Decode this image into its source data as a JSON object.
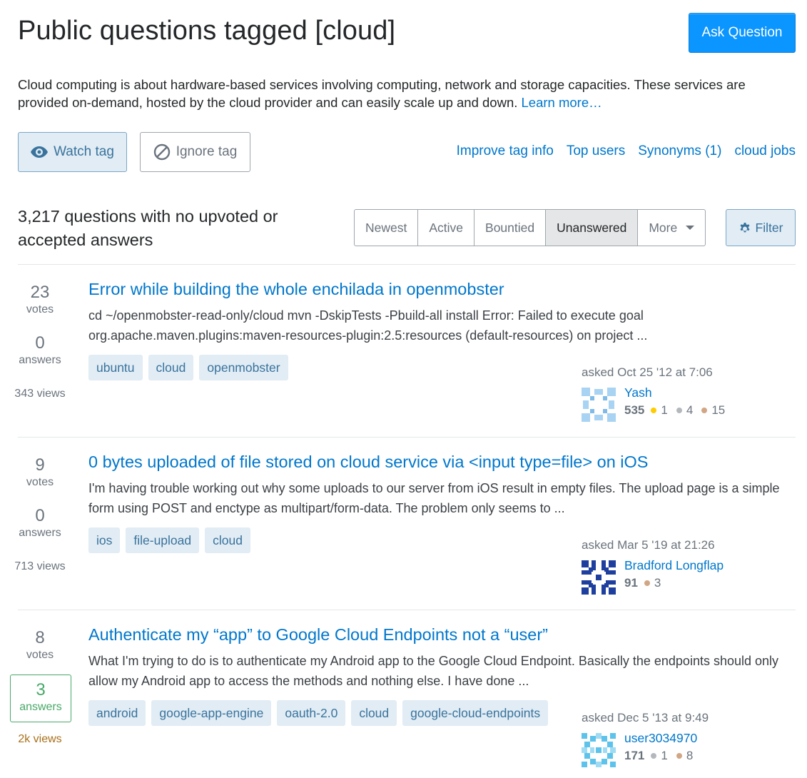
{
  "header": {
    "title": "Public questions tagged [cloud]",
    "ask_label": "Ask Question"
  },
  "description": {
    "text": "Cloud computing is about hardware-based services involving computing, network and storage capacities. These services are provided on-demand, hosted by the cloud provider and can easily scale up and down.",
    "learn_more": "Learn more…"
  },
  "tag_actions": {
    "watch_label": "Watch tag",
    "ignore_label": "Ignore tag",
    "links": [
      "Improve tag info",
      "Top users",
      "Synonyms (1)",
      "cloud jobs"
    ]
  },
  "count_text": "3,217 questions with no upvoted or accepted answers",
  "sort_tabs": [
    "Newest",
    "Active",
    "Bountied",
    "Unanswered",
    "More"
  ],
  "selected_tab": "Unanswered",
  "filter_label": "Filter",
  "colors": {
    "link": "#0077cc",
    "accent": "#0a95ff",
    "tag_bg": "#e1ecf4",
    "answered_green": "#48a868",
    "gold": "#ffcc01",
    "silver": "#b4b8bc",
    "bronze": "#d1a684"
  },
  "questions": [
    {
      "votes": "23",
      "votes_label": "votes",
      "answers": "0",
      "answers_label": "answers",
      "views": "343 views",
      "title": "Error while building the whole enchilada in openmobster",
      "excerpt": "cd ~/openmobster-read-only/cloud mvn -DskipTests -Pbuild-all install Error: Failed to execute goal org.apache.maven.plugins:maven-resources-plugin:2.5:resources (default-resources) on project ...",
      "tags": [
        "ubuntu",
        "cloud",
        "openmobster"
      ],
      "asked": "asked Oct 25 '12 at 7:06",
      "user": "Yash",
      "rep": "535",
      "gold": "1",
      "silver": "4",
      "bronze": "15"
    },
    {
      "votes": "9",
      "votes_label": "votes",
      "answers": "0",
      "answers_label": "answers",
      "views": "713 views",
      "title": "0 bytes uploaded of file stored on cloud service via <input type=file> on iOS",
      "excerpt": "I'm having trouble working out why some uploads to our server from iOS result in empty files. The upload page is a simple form using POST and enctype as multipart/form-data. The problem only seems to ...",
      "tags": [
        "ios",
        "file-upload",
        "cloud"
      ],
      "asked": "asked Mar 5 '19 at 21:26",
      "user": "Bradford Longflap",
      "rep": "91",
      "bronze": "3"
    },
    {
      "votes": "8",
      "votes_label": "votes",
      "answers": "3",
      "answers_label": "answers",
      "views": "2k views",
      "title": "Authenticate my “app” to Google Cloud Endpoints not a “user”",
      "excerpt": "What I'm trying to do is to authenticate my Android app to the Google Cloud Endpoint. Basically the endpoints should only allow my Android app to access the methods and nothing else. I have done ...",
      "tags": [
        "android",
        "google-app-engine",
        "oauth-2.0",
        "cloud",
        "google-cloud-endpoints"
      ],
      "asked": "asked Dec 5 '13 at 9:49",
      "user": "user3034970",
      "rep": "171",
      "silver": "1",
      "bronze": "8"
    }
  ]
}
